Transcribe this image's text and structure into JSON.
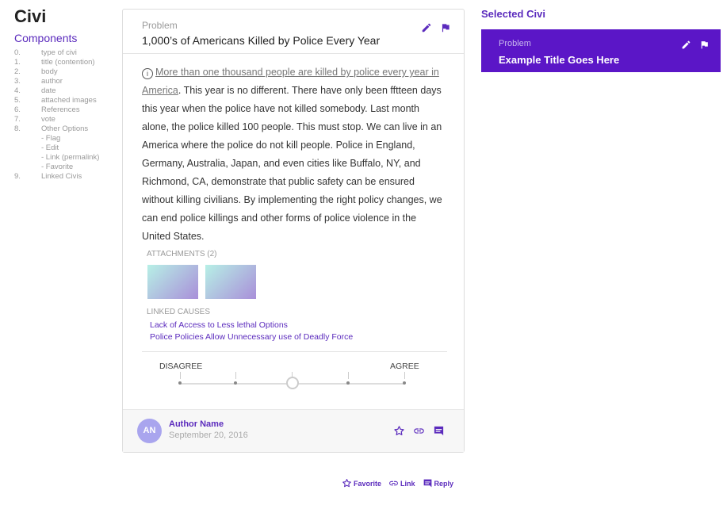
{
  "brand": "Civi",
  "components": {
    "title": "Components",
    "items": [
      {
        "num": "0.",
        "label": "type of civi"
      },
      {
        "num": "1.",
        "label": "title (contention)"
      },
      {
        "num": "2.",
        "label": "body"
      },
      {
        "num": "3.",
        "label": "author"
      },
      {
        "num": "4.",
        "label": "date"
      },
      {
        "num": "5.",
        "label": "attached images"
      },
      {
        "num": "6.",
        "label": "References"
      },
      {
        "num": "7.",
        "label": "vote"
      },
      {
        "num": "8.",
        "label": "Other Options"
      }
    ],
    "sub_items": [
      "- Flag",
      "- Edit",
      "- Link (permalink)",
      "- Favorite"
    ],
    "last": {
      "num": "9.",
      "label": "Linked Civis"
    }
  },
  "card": {
    "type": "Problem",
    "title": "1,000’s of Americans Killed by Police Every Year",
    "body_link": "More than one thousand people are killed by police every year in America",
    "body_rest": ". This year is no different. There have only been fftteen days this year when the police have not killed somebody. Last month alone, the police killed 100 people. This must stop. We can live in an America where the police do not kill people. Police in England, Germany, Australia, Japan, and even cities like Buffalo, NY, and Richmond, CA, demonstrate that public safety can be ensured without killing civilians. By implementing the right policy changes, we can end police killings and other forms of police violence in the United States.",
    "attachments_label": "ATTACHMENTS (2)",
    "linked_causes_label": "LINKED CAUSES",
    "linked_causes": [
      "Lack of Access to Less lethal Options",
      "Police Policies Allow Unnecessary use of Deadly Force"
    ],
    "vote": {
      "disagree": "DISAGREE",
      "agree": "AGREE",
      "value": 0.5
    },
    "author": {
      "initials": "AN",
      "name": "Author Name",
      "date": "September 20, 2016"
    }
  },
  "legend": {
    "favorite": "Favorite",
    "link": "Link",
    "reply": "Reply"
  },
  "selected": {
    "heading": "Selected Civi",
    "type": "Problem",
    "title": "Example Title Goes Here"
  },
  "colors": {
    "accent": "#5b2bbd",
    "selected_bg": "#5b16c7",
    "avatar": "#a9a5ee"
  },
  "icons": [
    "edit-icon",
    "flag-icon",
    "info-icon",
    "star-icon",
    "link-icon",
    "reply-icon"
  ]
}
